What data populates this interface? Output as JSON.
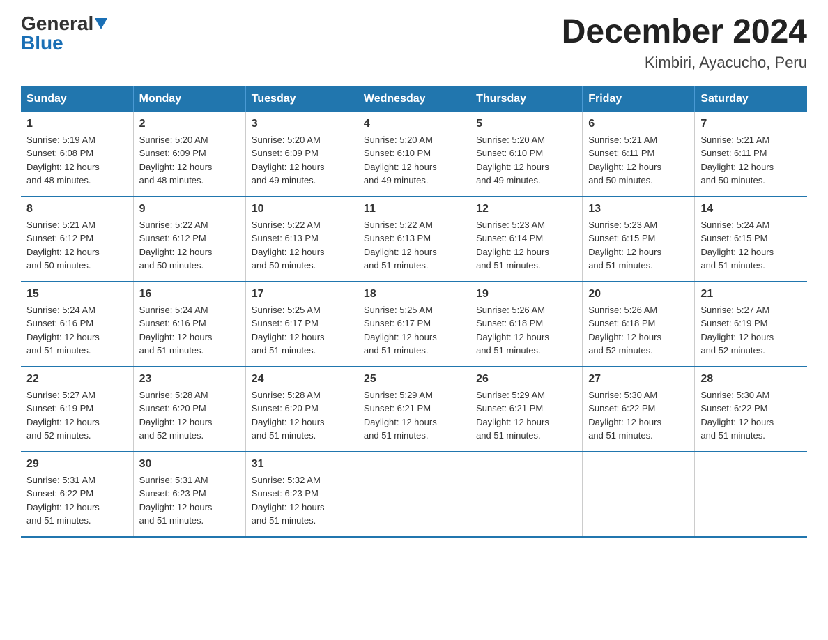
{
  "header": {
    "logo_general": "General",
    "logo_blue": "Blue",
    "month_title": "December 2024",
    "location": "Kimbiri, Ayacucho, Peru"
  },
  "days_of_week": [
    "Sunday",
    "Monday",
    "Tuesday",
    "Wednesday",
    "Thursday",
    "Friday",
    "Saturday"
  ],
  "weeks": [
    [
      {
        "day": "1",
        "sunrise": "5:19 AM",
        "sunset": "6:08 PM",
        "daylight": "12 hours and 48 minutes."
      },
      {
        "day": "2",
        "sunrise": "5:20 AM",
        "sunset": "6:09 PM",
        "daylight": "12 hours and 48 minutes."
      },
      {
        "day": "3",
        "sunrise": "5:20 AM",
        "sunset": "6:09 PM",
        "daylight": "12 hours and 49 minutes."
      },
      {
        "day": "4",
        "sunrise": "5:20 AM",
        "sunset": "6:10 PM",
        "daylight": "12 hours and 49 minutes."
      },
      {
        "day": "5",
        "sunrise": "5:20 AM",
        "sunset": "6:10 PM",
        "daylight": "12 hours and 49 minutes."
      },
      {
        "day": "6",
        "sunrise": "5:21 AM",
        "sunset": "6:11 PM",
        "daylight": "12 hours and 50 minutes."
      },
      {
        "day": "7",
        "sunrise": "5:21 AM",
        "sunset": "6:11 PM",
        "daylight": "12 hours and 50 minutes."
      }
    ],
    [
      {
        "day": "8",
        "sunrise": "5:21 AM",
        "sunset": "6:12 PM",
        "daylight": "12 hours and 50 minutes."
      },
      {
        "day": "9",
        "sunrise": "5:22 AM",
        "sunset": "6:12 PM",
        "daylight": "12 hours and 50 minutes."
      },
      {
        "day": "10",
        "sunrise": "5:22 AM",
        "sunset": "6:13 PM",
        "daylight": "12 hours and 50 minutes."
      },
      {
        "day": "11",
        "sunrise": "5:22 AM",
        "sunset": "6:13 PM",
        "daylight": "12 hours and 51 minutes."
      },
      {
        "day": "12",
        "sunrise": "5:23 AM",
        "sunset": "6:14 PM",
        "daylight": "12 hours and 51 minutes."
      },
      {
        "day": "13",
        "sunrise": "5:23 AM",
        "sunset": "6:15 PM",
        "daylight": "12 hours and 51 minutes."
      },
      {
        "day": "14",
        "sunrise": "5:24 AM",
        "sunset": "6:15 PM",
        "daylight": "12 hours and 51 minutes."
      }
    ],
    [
      {
        "day": "15",
        "sunrise": "5:24 AM",
        "sunset": "6:16 PM",
        "daylight": "12 hours and 51 minutes."
      },
      {
        "day": "16",
        "sunrise": "5:24 AM",
        "sunset": "6:16 PM",
        "daylight": "12 hours and 51 minutes."
      },
      {
        "day": "17",
        "sunrise": "5:25 AM",
        "sunset": "6:17 PM",
        "daylight": "12 hours and 51 minutes."
      },
      {
        "day": "18",
        "sunrise": "5:25 AM",
        "sunset": "6:17 PM",
        "daylight": "12 hours and 51 minutes."
      },
      {
        "day": "19",
        "sunrise": "5:26 AM",
        "sunset": "6:18 PM",
        "daylight": "12 hours and 51 minutes."
      },
      {
        "day": "20",
        "sunrise": "5:26 AM",
        "sunset": "6:18 PM",
        "daylight": "12 hours and 52 minutes."
      },
      {
        "day": "21",
        "sunrise": "5:27 AM",
        "sunset": "6:19 PM",
        "daylight": "12 hours and 52 minutes."
      }
    ],
    [
      {
        "day": "22",
        "sunrise": "5:27 AM",
        "sunset": "6:19 PM",
        "daylight": "12 hours and 52 minutes."
      },
      {
        "day": "23",
        "sunrise": "5:28 AM",
        "sunset": "6:20 PM",
        "daylight": "12 hours and 52 minutes."
      },
      {
        "day": "24",
        "sunrise": "5:28 AM",
        "sunset": "6:20 PM",
        "daylight": "12 hours and 51 minutes."
      },
      {
        "day": "25",
        "sunrise": "5:29 AM",
        "sunset": "6:21 PM",
        "daylight": "12 hours and 51 minutes."
      },
      {
        "day": "26",
        "sunrise": "5:29 AM",
        "sunset": "6:21 PM",
        "daylight": "12 hours and 51 minutes."
      },
      {
        "day": "27",
        "sunrise": "5:30 AM",
        "sunset": "6:22 PM",
        "daylight": "12 hours and 51 minutes."
      },
      {
        "day": "28",
        "sunrise": "5:30 AM",
        "sunset": "6:22 PM",
        "daylight": "12 hours and 51 minutes."
      }
    ],
    [
      {
        "day": "29",
        "sunrise": "5:31 AM",
        "sunset": "6:22 PM",
        "daylight": "12 hours and 51 minutes."
      },
      {
        "day": "30",
        "sunrise": "5:31 AM",
        "sunset": "6:23 PM",
        "daylight": "12 hours and 51 minutes."
      },
      {
        "day": "31",
        "sunrise": "5:32 AM",
        "sunset": "6:23 PM",
        "daylight": "12 hours and 51 minutes."
      },
      null,
      null,
      null,
      null
    ]
  ],
  "labels": {
    "sunrise": "Sunrise:",
    "sunset": "Sunset:",
    "daylight": "Daylight:"
  }
}
